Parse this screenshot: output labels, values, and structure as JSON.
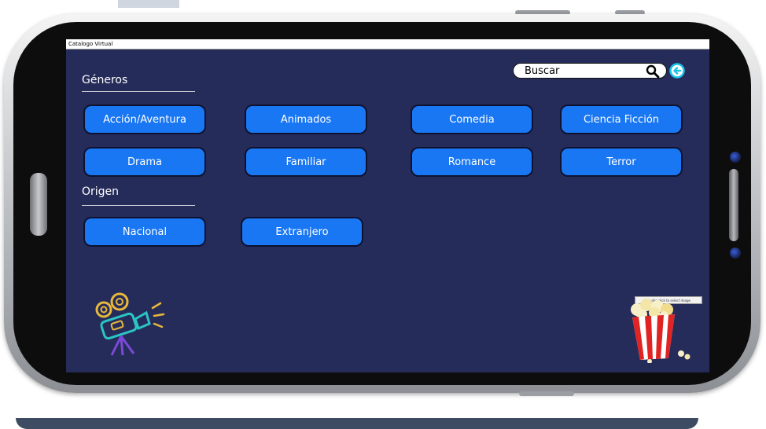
{
  "window": {
    "title": "Catalogo Virtual"
  },
  "search": {
    "value": "Buscar"
  },
  "generos": {
    "label": "Géneros",
    "items": [
      "Acción/Aventura",
      "Animados",
      "Comedia",
      "Ciencia Ficción",
      "Drama",
      "Familiar",
      "Romance",
      "Terror"
    ]
  },
  "origen": {
    "label": "Origen",
    "items": [
      "Nacional",
      "Extranjero"
    ]
  },
  "image_tooltip": "double click to select image",
  "colors": {
    "screen_bg": "#262c5a",
    "button": "#1977f3",
    "accent": "#19c3e6"
  },
  "icons": [
    "search-icon",
    "back-arrow-icon",
    "movie-camera-icon",
    "popcorn-icon"
  ]
}
